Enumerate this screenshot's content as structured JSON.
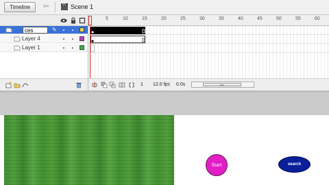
{
  "toolbar": {
    "timeline_label": "Timeline",
    "back_icon": "back-arrow-icon",
    "scene_icon": "clapper-icon",
    "scene_label": "Scene 1"
  },
  "layers": {
    "header_icons": [
      "eye-icon",
      "lock-icon",
      "outline-icon"
    ],
    "editing_value": "ces",
    "rows": [
      {
        "name": "ces",
        "selected": true,
        "outline_color": "#e8d94a"
      },
      {
        "name": "Layer 4",
        "selected": false,
        "outline_color": "#c040c0"
      },
      {
        "name": "Layer 1",
        "selected": false,
        "outline_color": "#39b54a"
      }
    ]
  },
  "timeline": {
    "ruler_numbers": [
      "5",
      "10",
      "15",
      "20",
      "25",
      "30",
      "35",
      "40",
      "45",
      "50",
      "55",
      "60"
    ],
    "current_frame": "1",
    "fps": "12.0 fps",
    "time": "0.0s"
  },
  "stage": {
    "start_label": "Start",
    "search_label": "search",
    "start_color": "#e21fc6",
    "search_color": "#0c1f9a"
  }
}
